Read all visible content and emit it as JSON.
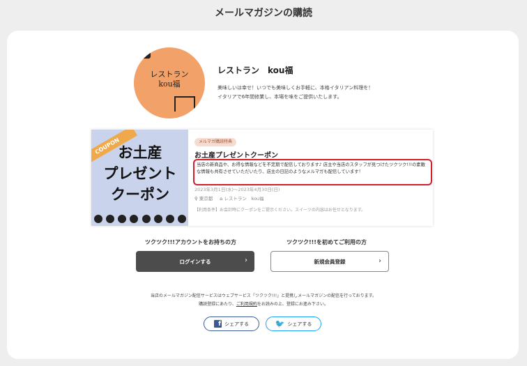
{
  "page": {
    "title": "メールマガジンの購読"
  },
  "shop": {
    "logo_text_line1": "レストラン",
    "logo_text_line2": "kou福",
    "name": "レストラン　kou福",
    "desc_line1": "美味しいは幸せ！いつでも美味しくお手軽に、本格イタリアン料理を！",
    "desc_line2": "イタリアで6年間修業し、本場を味をご提供いたします。"
  },
  "coupon": {
    "image_ribbon": "COUPON",
    "image_text_line1": "お土産",
    "image_text_line2": "プレゼント",
    "image_text_line3": "クーポン",
    "badge": "メルマガ購読特典",
    "title": "お土産プレゼントクーポン",
    "description": "当店の新商品や、お得な情報などを不定期で配信しております♪ 店主や当店のスタッフが見つけたツクツク!!!の素敵な情報も共有させていただいたり、店主の日記のようなメルマガも配信しています！",
    "period": "2023年3月1日(水)〜2023年4月30日(日)",
    "area": "東京都",
    "shop": "レストラン　kou福",
    "conditions": "【利用条件】お会計時にクーポンをご提示ください。スイーツの内容はお任せとなります。"
  },
  "actions": {
    "login_caption": "ツクツク!!!アカウントをお持ちの方",
    "login_label": "ログインする",
    "register_caption": "ツクツク!!!を初めてご利用の方",
    "register_label": "新規会員登録",
    "chevron": "›"
  },
  "notice": {
    "line1": "当店のメールマガジン配信サービスはウェブサービス「ツクツク!!!」と提携しメールマガジンの配信を行っております。",
    "line2_pre": "購読登録にあたり、",
    "line2_link": "ご利用規約",
    "line2_post": "をお読みの上、登録にお進み下さい。"
  },
  "share": {
    "facebook_label": "シェアする",
    "twitter_label": "シェアする"
  },
  "colors": {
    "highlight_border": "#d21d2a",
    "logo_bg": "#f2a268",
    "login_bg": "#4c4c4c"
  }
}
